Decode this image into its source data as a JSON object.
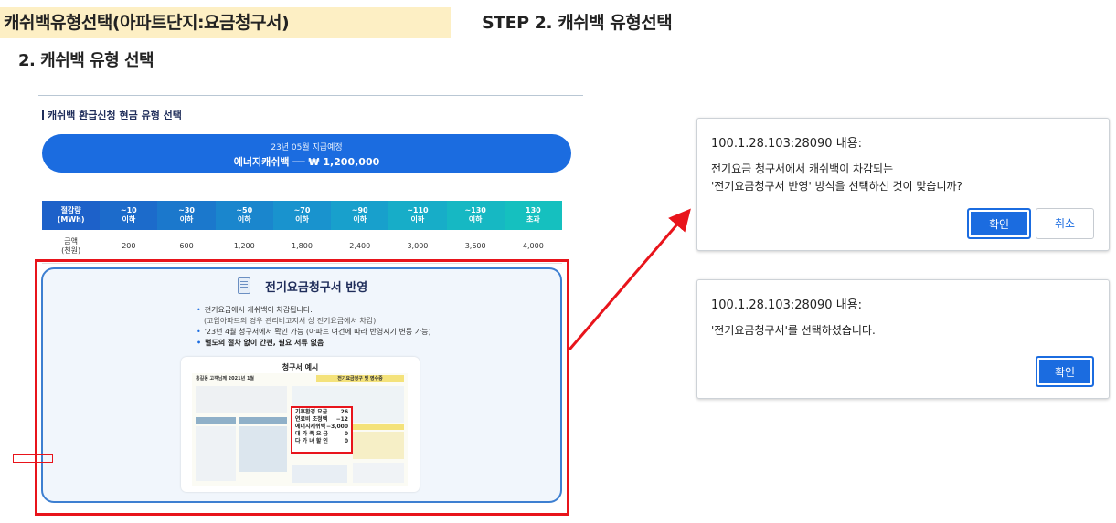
{
  "header": {
    "title": "캐쉬백유형선택(아파트단지:요금청구서)",
    "step": "STEP 2. 캐쉬백 유형선택",
    "section_title": "2. 캐쉬백 유형 선택"
  },
  "panel": {
    "heading": "캐쉬백 환급신청 현금 유형 선택",
    "pill_sub": "23년 05월 지급예정",
    "pill_main": "에너지캐쉬백 ── ₩ 1,200,000",
    "table": {
      "header_label": [
        "절감량",
        "(MWh)"
      ],
      "columns": [
        [
          "~10",
          "이하"
        ],
        [
          "~30",
          "이하"
        ],
        [
          "~50",
          "이하"
        ],
        [
          "~70",
          "이하"
        ],
        [
          "~90",
          "이하"
        ],
        [
          "~110",
          "이하"
        ],
        [
          "~130",
          "이하"
        ],
        [
          "130",
          "초과"
        ]
      ],
      "row_label": [
        "금액",
        "(천원)"
      ],
      "values": [
        "200",
        "600",
        "1,200",
        "1,800",
        "2,400",
        "3,000",
        "3,600",
        "4,000"
      ],
      "header_colors": [
        "#1d61c9",
        "#1c6bcb",
        "#1b78cc",
        "#1a86cd",
        "#1993ce",
        "#18a0cc",
        "#17adc8",
        "#16b8c3",
        "#15c0bf"
      ]
    },
    "option": {
      "title": "전기요금청구서 반영",
      "bullets": [
        "전기요금에서 캐쉬백이 차감됩니다.",
        "(고압아파트의 경우 관리비고지서 상 전기요금에서 차감)",
        "'23년 4월 청구서에서 확인 가능 (아파트 여건에 따라 반영시기 변동 가능)",
        "별도의 절차 없이 간편, 필요 서류 없음"
      ]
    },
    "bill": {
      "title": "청구서 예시",
      "header_left": "홍길동   고객님께   2021년 1월",
      "header_right": "전기요금청구 및 영수증",
      "popout_rows": [
        {
          "label": "기후환경 요금",
          "value": "26"
        },
        {
          "label": "연료비 조정액",
          "value": "−12"
        },
        {
          "label": "에너지캐쉬백",
          "value": "−3,000"
        },
        {
          "label": "대 가 족 요 금",
          "value": "0"
        },
        {
          "label": "다 가 녀 할 인",
          "value": "0"
        }
      ]
    }
  },
  "dialog_confirm": {
    "origin": "100.1.28.103:28090 내용:",
    "message_line1": "전기요금 청구서에서 캐쉬백이 차감되는",
    "message_line2": "'전기요금청구서 반영' 방식을 선택하신 것이 맞습니까?",
    "ok_label": "확인",
    "cancel_label": "취소"
  },
  "dialog_alert": {
    "origin": "100.1.28.103:28090 내용:",
    "message": "'전기요금청구서'를 선택하셨습니다.",
    "ok_label": "확인"
  },
  "colors": {
    "highlight_bg": "#fdefc4",
    "accent_blue": "#1b6ce0",
    "annotation_red": "#e8141b"
  }
}
